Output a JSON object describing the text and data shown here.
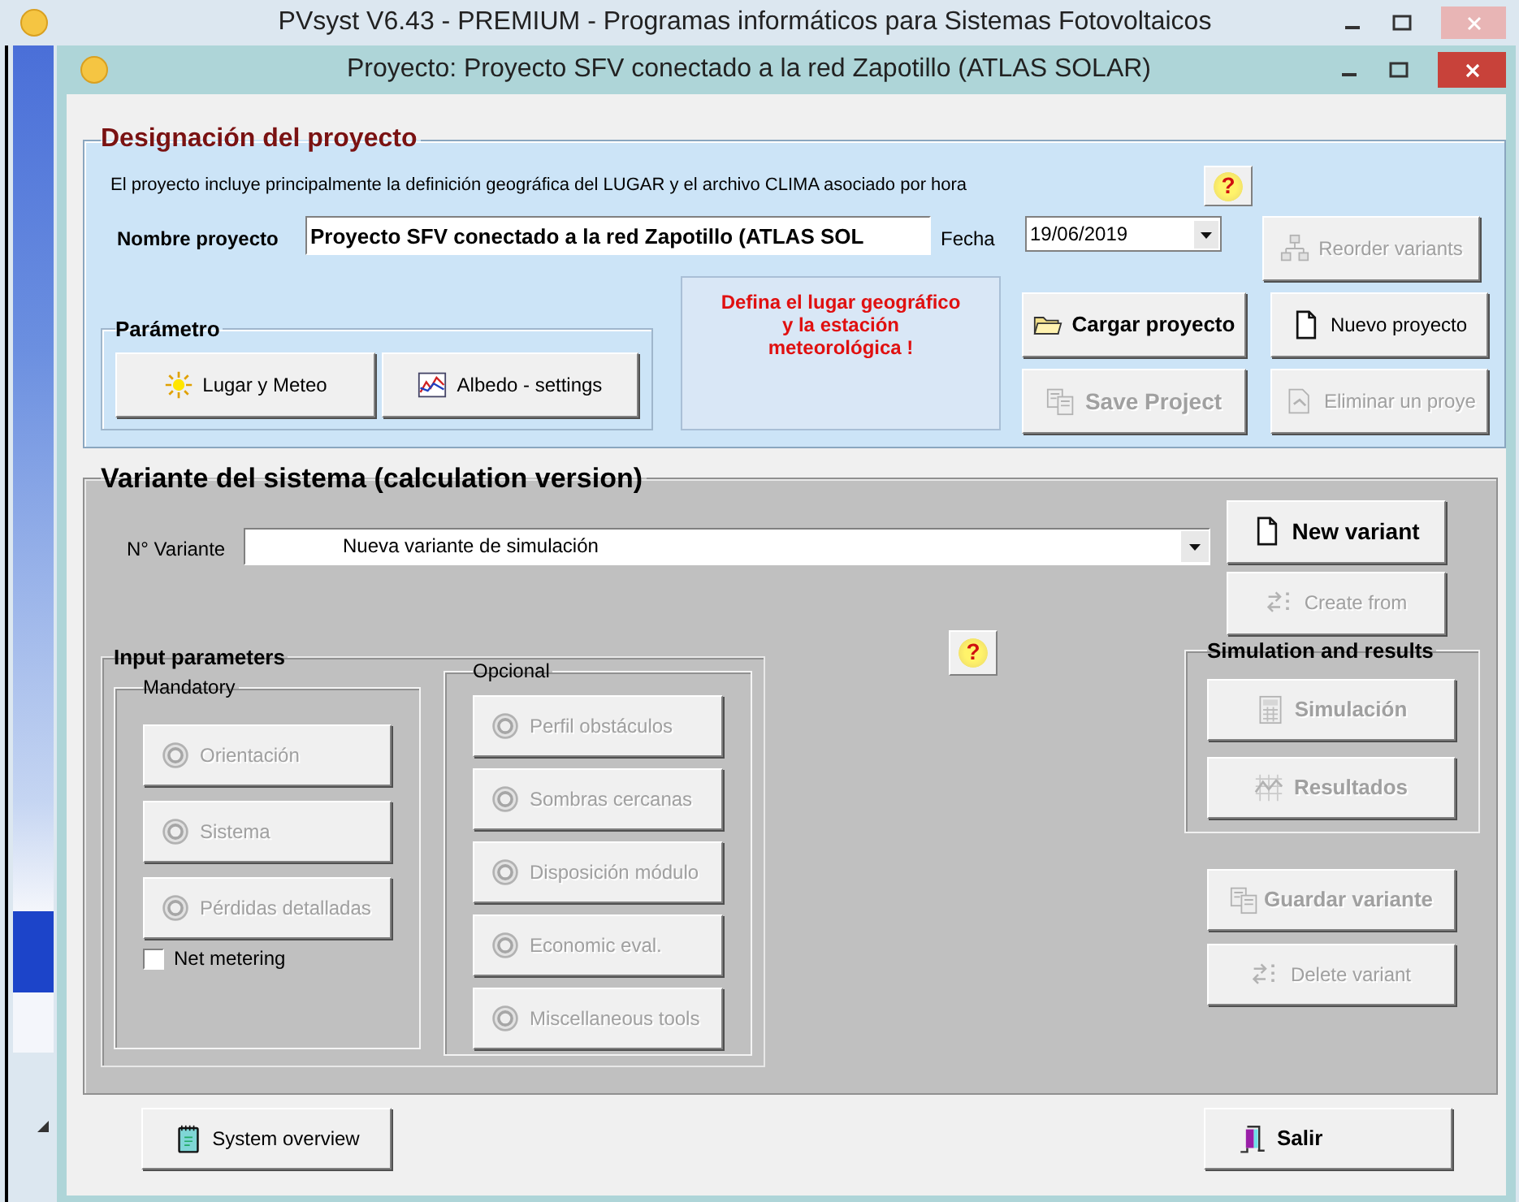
{
  "app_window": {
    "title": "PVsyst V6.43 - PREMIUM - Programas informáticos para Sistemas Fotovoltaicos"
  },
  "project_window": {
    "title": "Proyecto:  Proyecto SFV conectado a la red Zapotillo (ATLAS SOLAR)"
  },
  "designation": {
    "legend": "Designación del proyecto",
    "description": "El proyecto incluye principalmente la definición geográfica del LUGAR y el archivo CLIMA asociado por hora",
    "help": "?",
    "name_label": "Nombre proyecto",
    "name_value": "Proyecto SFV conectado a la red Zapotillo (ATLAS SOL",
    "date_label": "Fecha",
    "date_value": "19/06/2019",
    "notice": "Defina el lugar geográfico\ny la estación\nmeteorológica !",
    "buttons": [
      {
        "label": "Reorder variants",
        "disabled": true
      },
      {
        "label": "Cargar proyecto",
        "disabled": false
      },
      {
        "label": "Nuevo proyecto",
        "disabled": false
      },
      {
        "label": "Save Project",
        "disabled": true
      },
      {
        "label": "Eliminar un proye",
        "disabled": true
      }
    ],
    "parameter": {
      "legend": "Parámetro",
      "buttons": [
        {
          "label": "Lugar y Meteo",
          "disabled": false
        },
        {
          "label": "Albedo - settings",
          "disabled": false
        }
      ]
    }
  },
  "variant": {
    "legend": "Variante del sistema (calculation version)",
    "variant_label": "N° Variante",
    "variant_value": "Nueva variante de simulación",
    "buttons": [
      {
        "label": "New variant",
        "disabled": false
      },
      {
        "label": "Create from",
        "disabled": true
      }
    ],
    "input_parameters": {
      "legend": "Input parameters",
      "mandatory": {
        "legend": "Mandatory",
        "buttons": [
          {
            "label": "Orientación",
            "disabled": true
          },
          {
            "label": "Sistema",
            "disabled": true
          },
          {
            "label": "Pérdidas detalladas",
            "disabled": true
          }
        ]
      },
      "net_metering": {
        "label": "Net metering",
        "checked": false
      },
      "optional": {
        "legend": "Opcional",
        "buttons": [
          {
            "label": "Perfil obstáculos",
            "disabled": true
          },
          {
            "label": "Sombras cercanas",
            "disabled": true
          },
          {
            "label": "Disposición módulo",
            "disabled": true
          },
          {
            "label": "Economic eval.",
            "disabled": true
          },
          {
            "label": "Miscellaneous tools",
            "disabled": true
          }
        ]
      }
    },
    "help": "?",
    "simulation": {
      "legend": "Simulation and results",
      "buttons": [
        {
          "label": "Simulación",
          "disabled": true
        },
        {
          "label": "Resultados",
          "disabled": true
        }
      ]
    },
    "variant_buttons": [
      {
        "label": "Guardar variante",
        "disabled": true
      },
      {
        "label": "Delete variant",
        "disabled": true
      }
    ]
  },
  "footer_buttons": [
    {
      "label": "System overview",
      "disabled": false
    },
    {
      "label": "Salir",
      "disabled": false
    }
  ]
}
